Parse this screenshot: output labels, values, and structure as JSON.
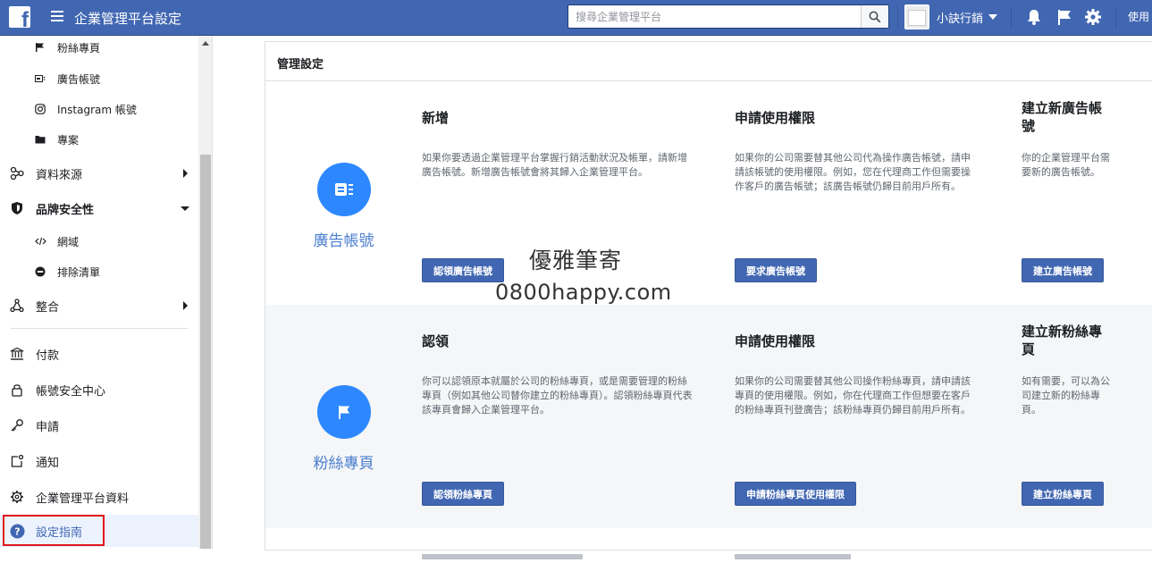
{
  "topbar": {
    "app_title": "企業管理平台設定",
    "search_placeholder": "搜尋企業管理平台",
    "business_name": "小訣行銷",
    "user_label": "使用"
  },
  "sidebar": {
    "sub_items_top": [
      {
        "label": "粉絲專頁",
        "icon": "flag-icon"
      },
      {
        "label": "廣告帳號",
        "icon": "ad-account-icon"
      },
      {
        "label": "Instagram 帳號",
        "icon": "instagram-icon"
      },
      {
        "label": "專案",
        "icon": "folder-icon"
      }
    ],
    "data_sources": "資料來源",
    "brand_safety": "品牌安全性",
    "brand_safety_items": [
      {
        "label": "網域",
        "icon": "code-icon"
      },
      {
        "label": "排除清單",
        "icon": "block-icon"
      }
    ],
    "integrations": "整合",
    "bottom_items": [
      {
        "label": "付款",
        "icon": "bank-icon"
      },
      {
        "label": "帳號安全中心",
        "icon": "lock-icon"
      },
      {
        "label": "申請",
        "icon": "key-icon"
      },
      {
        "label": "通知",
        "icon": "notification-icon"
      },
      {
        "label": "企業管理平台資料",
        "icon": "gear-icon"
      },
      {
        "label": "設定指南",
        "icon": "help-icon"
      }
    ]
  },
  "main": {
    "panel_title": "管理設定",
    "rows": [
      {
        "category": "廣告帳號",
        "columns": [
          {
            "title": "新增",
            "desc": "如果你要透過企業管理平台掌握行銷活動狀況及帳單，請新增廣告帳號。新增廣告帳號會將其歸入企業管理平台。",
            "button": "認領廣告帳號"
          },
          {
            "title": "申請使用權限",
            "desc": "如果你的公司需要替其他公司代為操作廣告帳號，請申請該帳號的使用權限。例如，您在代理商工作但需要操作客戶的廣告帳號；該廣告帳號仍歸目前用戶所有。",
            "button": "要求廣告帳號"
          },
          {
            "title": "建立新廣告帳號",
            "desc": "你的企業管理平台需要新的廣告帳號。",
            "button": "建立廣告帳號"
          }
        ]
      },
      {
        "category": "粉絲專頁",
        "columns": [
          {
            "title": "認領",
            "desc": "你可以認領原本就屬於公司的粉絲專頁，或是需要管理的粉絲專頁（例如其他公司替你建立的粉絲專頁）。認領粉絲專頁代表該專頁會歸入企業管理平台。",
            "button": "認領粉絲專頁"
          },
          {
            "title": "申請使用權限",
            "desc": "如果你的公司需要替其他公司操作粉絲專頁，請申請該專頁的使用權限。例如，你在代理商工作但想要在客戶的粉絲專頁刊登廣告；該粉絲專頁仍歸目前用戶所有。",
            "button": "申請粉絲專頁使用權限"
          },
          {
            "title": "建立新粉絲專頁",
            "desc": "如有需要，可以為公司建立新的粉絲專頁。",
            "button": "建立粉絲專頁"
          }
        ]
      }
    ]
  },
  "watermark": {
    "line1": "優雅筆寄",
    "line2": "0800happy.com"
  },
  "colors": {
    "topbar": "#4267b2",
    "button": "#4267b2",
    "circle": "#2d88ff",
    "highlight": "#e0141e"
  }
}
